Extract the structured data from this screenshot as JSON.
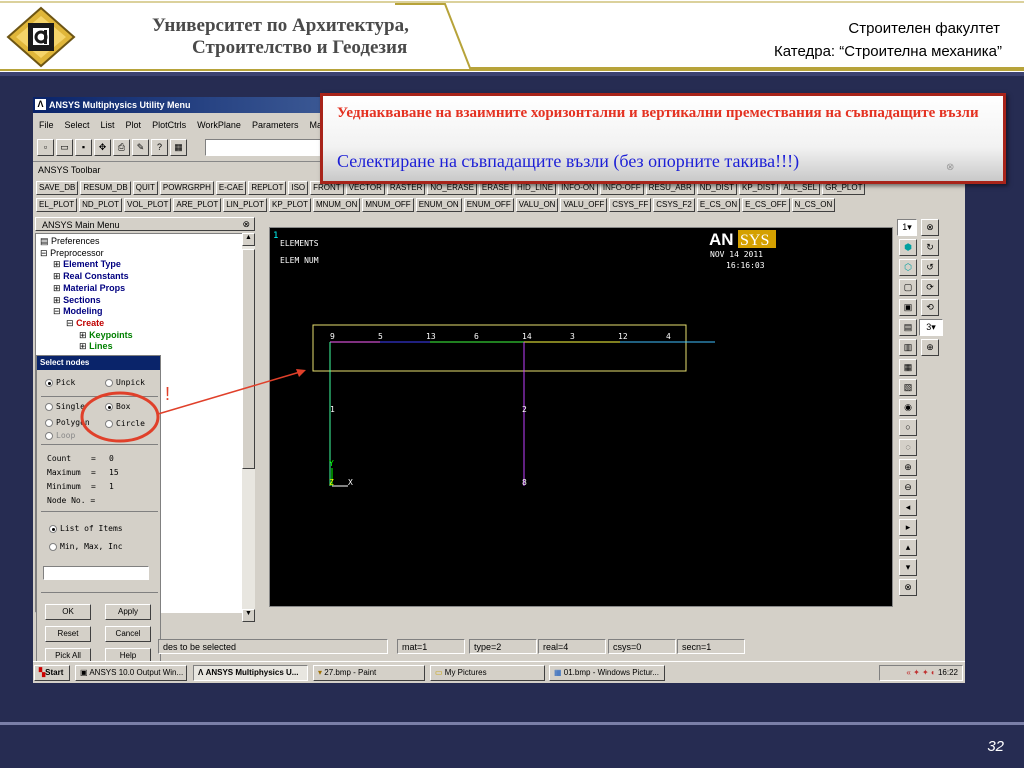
{
  "header": {
    "university_line1": "Университет по Архитектура,",
    "university_line2": "Строителство и Геодезия",
    "faculty": "Строителен факултет",
    "department": "Катедра: “Строителна механика”"
  },
  "window": {
    "title": "ANSYS Multiphysics Utility Menu",
    "menu": [
      "File",
      "Select",
      "List",
      "Plot",
      "PlotCtrls",
      "WorkPlane",
      "Parameters",
      "Ma"
    ]
  },
  "toolbar": {
    "label": "ANSYS Toolbar",
    "row1": [
      "SAVE_DB",
      "RESUM_DB",
      "QUIT",
      "POWRGRPH",
      "E-CAE",
      "REPLOT",
      "ISO",
      "FRONT",
      "VECTOR",
      "RASTER",
      "NO_ERASE",
      "ERASE",
      "HID_LINE",
      "INFO-ON",
      "INFO-OFF",
      "RESU_ABR",
      "ND_DIST",
      "KP_DIST",
      "ALL_SEL",
      "GR_PLOT"
    ],
    "row2": [
      "EL_PLOT",
      "ND_PLOT",
      "VOL_PLOT",
      "ARE_PLOT",
      "LIN_PLOT",
      "KP_PLOT",
      "MNUM_ON",
      "MNUM_OFF",
      "ENUM_ON",
      "ENUM_OFF",
      "VALU_ON",
      "VALU_OFF",
      "CSYS_FF",
      "CSYS_F2",
      "E_CS_ON",
      "E_CS_OFF",
      "N_CS_ON"
    ]
  },
  "main_menu": {
    "title": "ANSYS Main Menu",
    "items": [
      {
        "label": "Preferences",
        "prefix": "▤",
        "indent": 0,
        "color": "#000000"
      },
      {
        "label": "Preprocessor",
        "prefix": "⊟",
        "indent": 0,
        "color": "#000000"
      },
      {
        "label": "Element Type",
        "prefix": "⊞",
        "indent": 1,
        "color": "#000080"
      },
      {
        "label": "Real Constants",
        "prefix": "⊞",
        "indent": 1,
        "color": "#000080"
      },
      {
        "label": "Material Props",
        "prefix": "⊞",
        "indent": 1,
        "color": "#000080"
      },
      {
        "label": "Sections",
        "prefix": "⊞",
        "indent": 1,
        "color": "#000080"
      },
      {
        "label": "Modeling",
        "prefix": "⊟",
        "indent": 1,
        "color": "#000080"
      },
      {
        "label": "Create",
        "prefix": "⊟",
        "indent": 2,
        "color": "#c00000"
      },
      {
        "label": "Keypoints",
        "prefix": "⊞",
        "indent": 3,
        "color": "#008000"
      },
      {
        "label": "Lines",
        "prefix": "⊞",
        "indent": 3,
        "color": "#008000"
      }
    ]
  },
  "dialog": {
    "title": "Select nodes",
    "pick": "Pick",
    "unpick": "Unpick",
    "single": "Single",
    "box": "Box",
    "polygon": "Polygon",
    "circle": "Circle",
    "loop": "Loop",
    "count_label": "Count",
    "count_value": "0",
    "max_label": "Maximum",
    "max_value": "15",
    "min_label": "Minimum",
    "min_value": "1",
    "nodeno_label": "Node No. =",
    "list_items": "List of Items",
    "minmax": "Min, Max, Inc",
    "ok": "OK",
    "apply": "Apply",
    "reset": "Reset",
    "cancel": "Cancel",
    "pickall": "Pick All",
    "help": "Help"
  },
  "graphics": {
    "window_no": "1",
    "label1": "ELEMENTS",
    "label2": "ELEM NUM",
    "logo_an": "AN",
    "logo_sys": "SYS",
    "date": "NOV 14 2011",
    "time": "16:16:03",
    "top_labels": [
      "9",
      "5",
      "13",
      "6",
      "14",
      "3",
      "12",
      "4"
    ],
    "label_1": "1",
    "label_2": "2",
    "label_8": "8",
    "axis_y": "Y",
    "axis_x": "X",
    "axis_z": "Z",
    "exclamation": "!"
  },
  "right_toolbar": {
    "window_select": "1",
    "view_select": "3"
  },
  "status": {
    "prompt": "des to be selected",
    "mat": "mat=1",
    "type": "type=2",
    "real": "real=4",
    "csys": "csys=0",
    "secn": "secn=1"
  },
  "taskbar": {
    "start": "Start",
    "tasks": [
      "ANSYS 10.0 Output Win...",
      "ANSYS Multiphysics U...",
      "27.bmp - Paint",
      "My Pictures",
      "01.bmp - Windows Pictur..."
    ],
    "clock": "16:22"
  },
  "callout": {
    "heading": "Уеднакваване на взаимните хоризонтални и вертикални премествания на съвпадащите възли",
    "subtitle": "Селектиране на съвпадащите възли (без опорните такива!!!)"
  },
  "page_number": "32"
}
